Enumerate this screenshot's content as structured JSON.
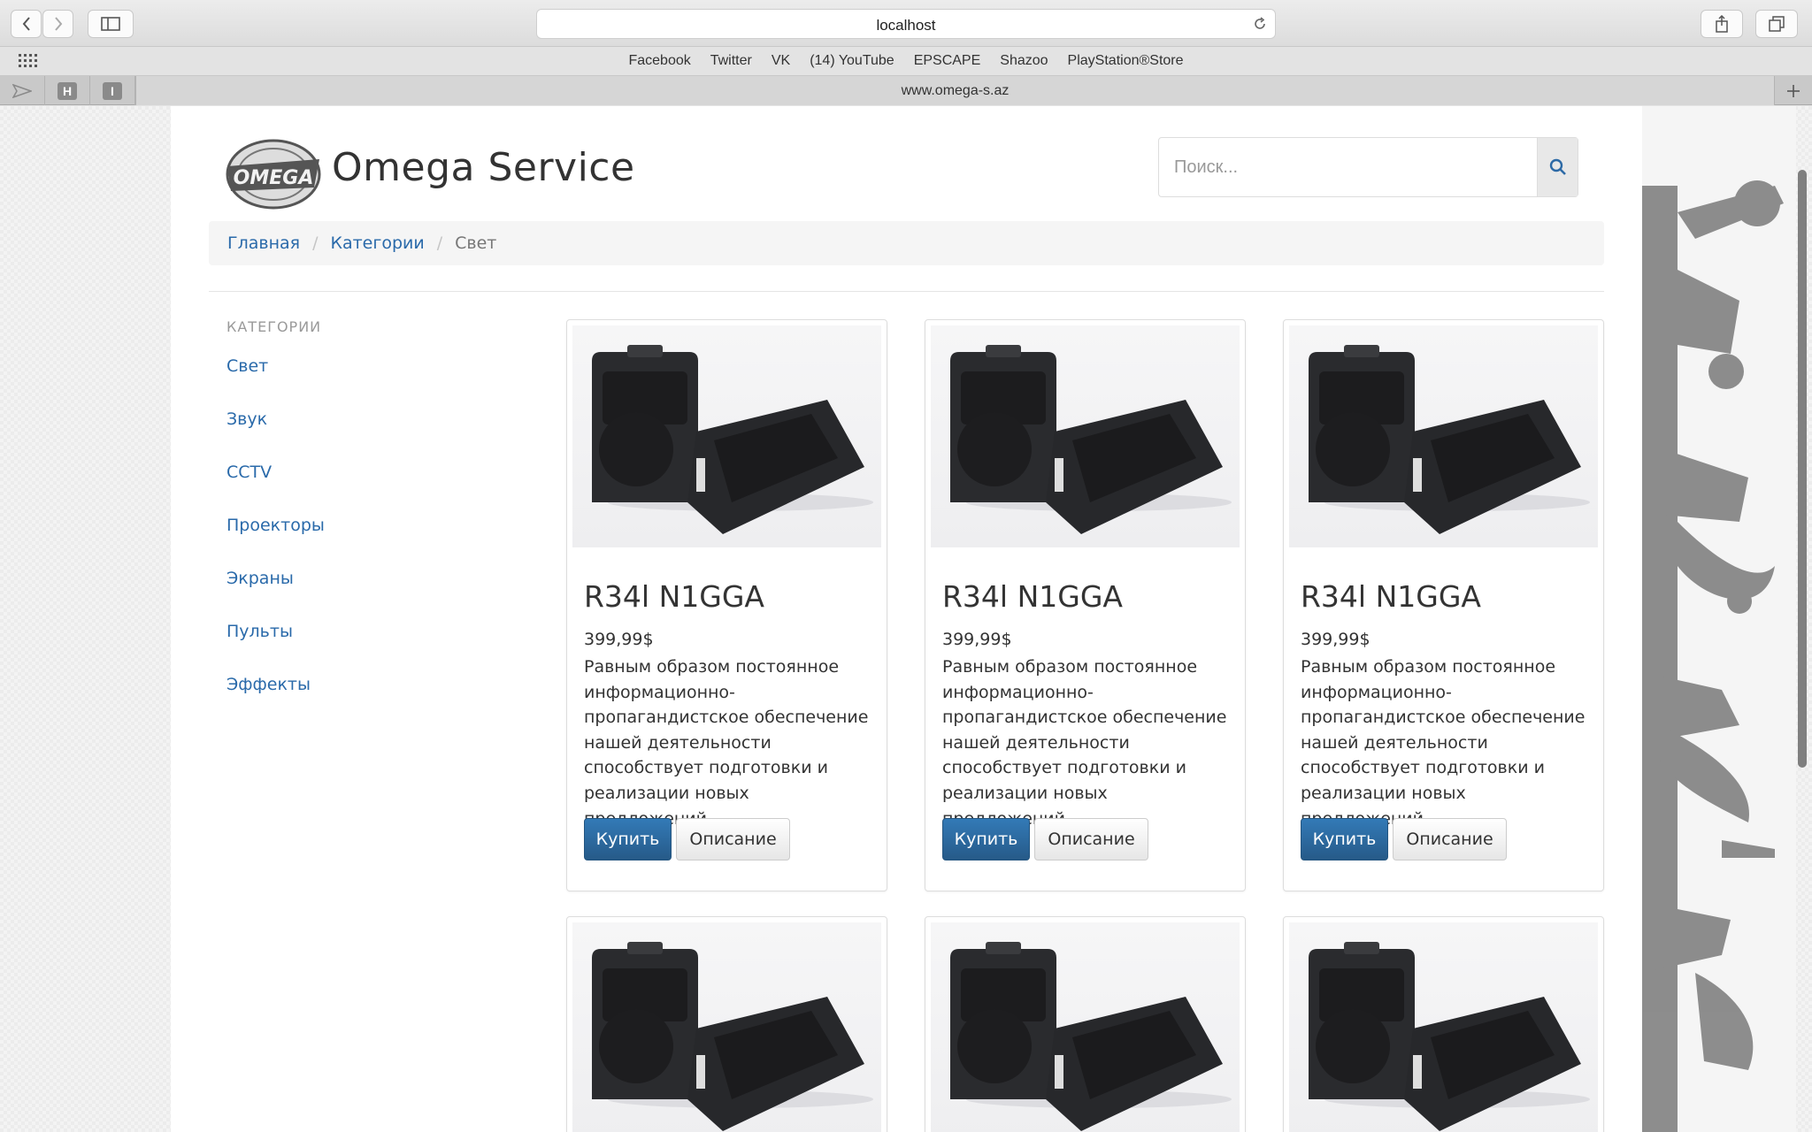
{
  "browser": {
    "address": "localhost",
    "favorites": [
      "Facebook",
      "Twitter",
      "VK",
      "(14) YouTube",
      "EPSCAPE",
      "Shazoo",
      "PlayStation®Store"
    ],
    "tab_title": "www.omega-s.az",
    "tab_pinned": [
      "H",
      "I"
    ]
  },
  "site": {
    "brand": "Omega Service",
    "logo_text": "OMEGA",
    "search_placeholder": "Поиск..."
  },
  "breadcrumb": {
    "home": "Главная",
    "categories": "Категории",
    "current": "Свет"
  },
  "sidebar": {
    "heading": "КАТЕГОРИИ",
    "items": [
      "Свет",
      "Звук",
      "CCTV",
      "Проекторы",
      "Экраны",
      "Пульты",
      "Эффекты"
    ]
  },
  "products": [
    {
      "title": "R34l N1GGA",
      "price": "399,99$",
      "desc": "Равным образом постоянное информационно-пропагандистское обеспечение нашей деятельности способствует подготовки и реализации новых предложений.",
      "buy": "Купить",
      "details": "Описание"
    },
    {
      "title": "R34l N1GGA",
      "price": "399,99$",
      "desc": "Равным образом постоянное информационно-пропагандистское обеспечение нашей деятельности способствует подготовки и реализации новых предложений.",
      "buy": "Купить",
      "details": "Описание"
    },
    {
      "title": "R34l N1GGA",
      "price": "399,99$",
      "desc": "Равным образом постоянное информационно-пропагандистское обеспечение нашей деятельности способствует подготовки и реализации новых предложений.",
      "buy": "Купить",
      "details": "Описание"
    }
  ],
  "colors": {
    "link": "#2a6aaa",
    "primary": "#2d6aa6",
    "breadcrumb_bg": "#f5f5f5"
  }
}
